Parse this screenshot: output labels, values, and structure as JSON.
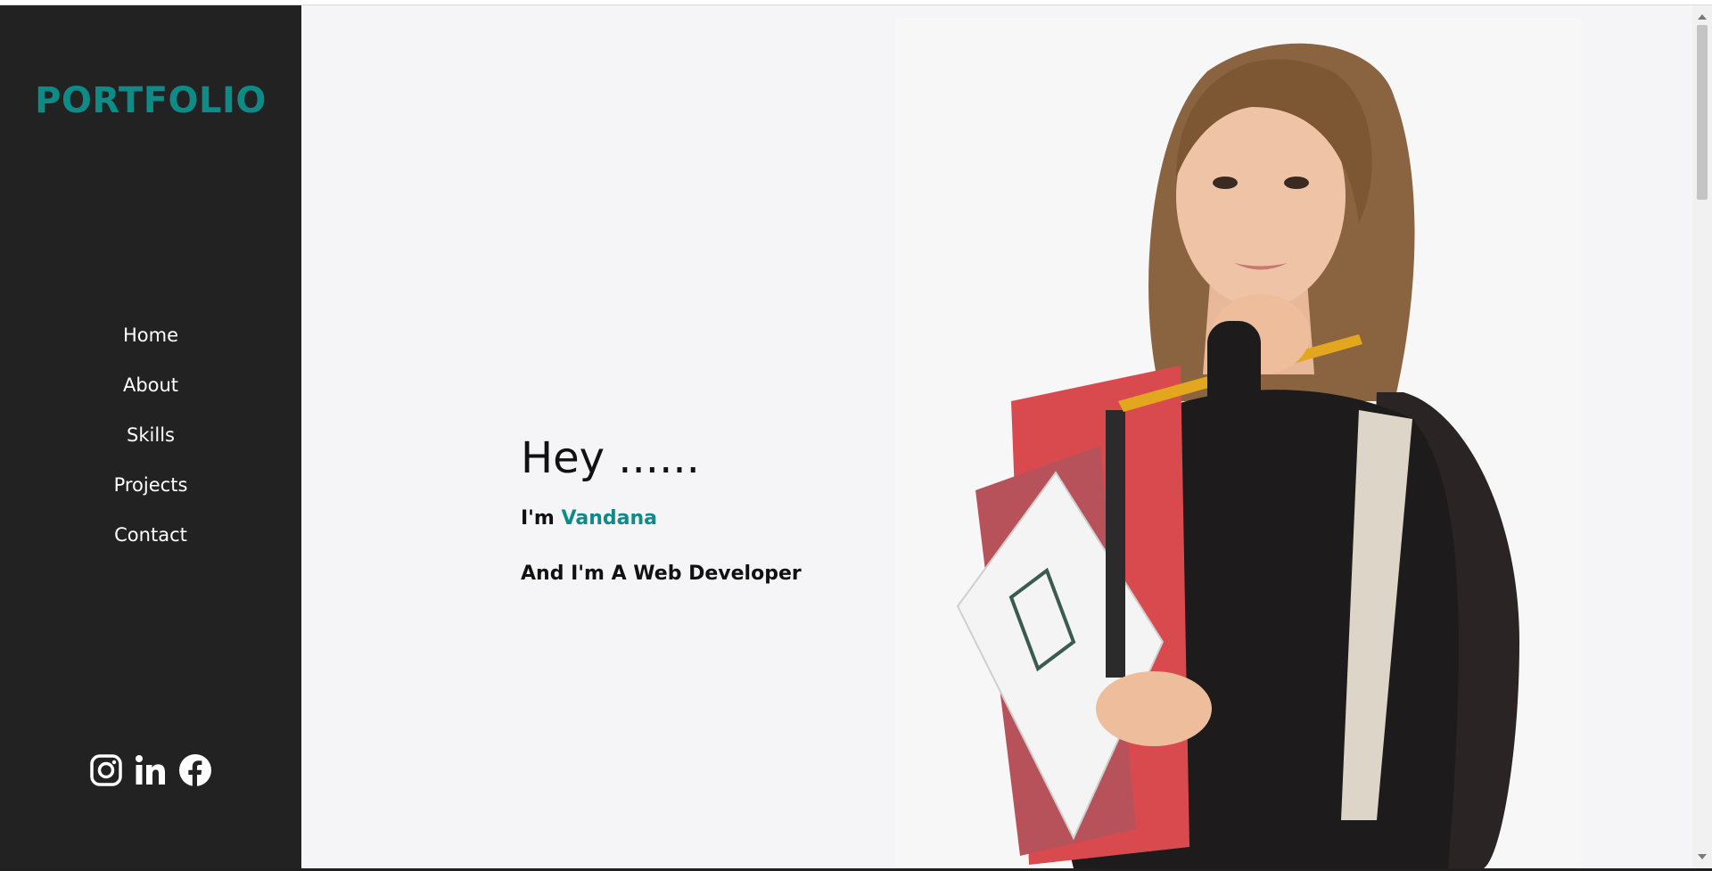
{
  "sidebar": {
    "logo": "PORTFOLIO",
    "nav": [
      {
        "label": "Home"
      },
      {
        "label": "About"
      },
      {
        "label": "Skills"
      },
      {
        "label": "Projects"
      },
      {
        "label": "Contact"
      }
    ],
    "socials": [
      {
        "icon": "instagram-icon"
      },
      {
        "icon": "linkedin-icon"
      },
      {
        "icon": "facebook-icon"
      }
    ]
  },
  "hero": {
    "greeting": "Hey ......",
    "intro_prefix": "I'm",
    "name": "Vandana",
    "role": "And I'm A Web Developer"
  },
  "colors": {
    "accent": "#0e8a87",
    "sidebar_bg": "#222222",
    "page_bg": "#f5f5f7"
  }
}
